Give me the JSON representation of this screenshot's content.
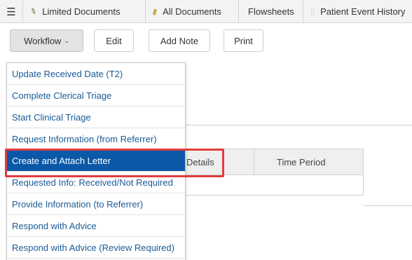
{
  "tabs": [
    {
      "label": "Limited Documents",
      "icon": "pencil-icon"
    },
    {
      "label": "All Documents",
      "icon": "folder-icon"
    },
    {
      "label": "Flowsheets",
      "icon": ""
    },
    {
      "label": "Patient Event History",
      "icon": "document-icon"
    }
  ],
  "toolbar": {
    "workflow_label": "Workflow",
    "edit_label": "Edit",
    "add_note_label": "Add Note",
    "print_label": "Print"
  },
  "table": {
    "columns": [
      "Details",
      "Time Period"
    ]
  },
  "workflow_menu": {
    "items": [
      "Update Received Date (T2)",
      "Complete Clerical Triage",
      "Start Clinical Triage",
      "Request Information (from Referrer)",
      "Create and Attach Letter",
      "Requested Info: Received/Not Required",
      "Provide Information (to Referrer)",
      "Respond with Advice",
      "Respond with Advice (Review Required)"
    ],
    "selected": "Create and Attach Letter"
  },
  "colors": {
    "menu_text": "#1a5a95",
    "selected_bg": "#0b58a8",
    "highlight_border": "#e03c3c"
  }
}
